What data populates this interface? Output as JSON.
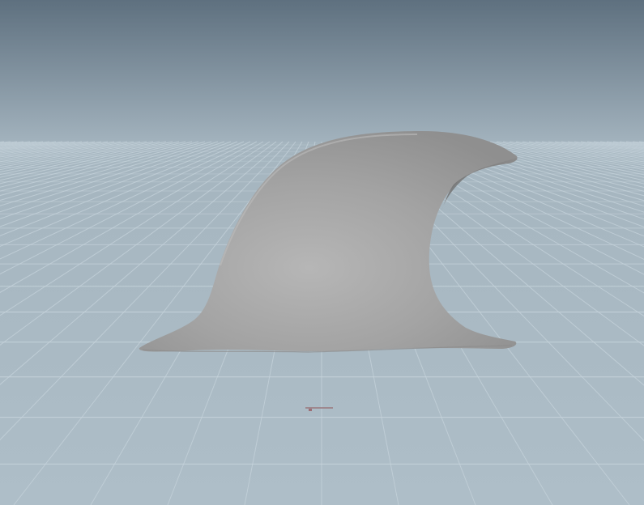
{
  "viewport": {
    "background_top_color": "#5f7180",
    "background_horizon_color": "#a2b2bd",
    "floor_color": "#a8b8c2",
    "grid_line_color": "#c5d2da",
    "model_color": "#a2a2a2",
    "model_highlight_color": "#b4b4b4",
    "model_shadow_color": "#777777",
    "model_name": "shark-fin-mesh",
    "origin_marker_icon": "origin-marker-icon",
    "origin_marker_color": "#9b6f76"
  }
}
